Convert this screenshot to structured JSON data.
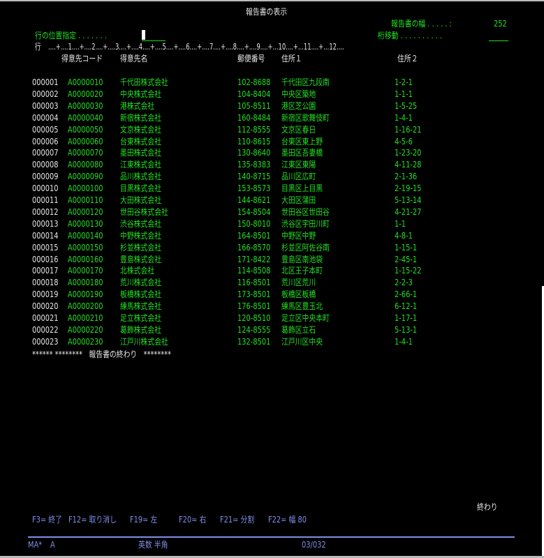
{
  "title": "報告書の表示",
  "report_width_label": "報告書の幅 . . . . . :",
  "report_width_value": "252",
  "position_label": "行の位置指定 . . . . . . .",
  "position_value": "",
  "shift_label": "桁移動 . . . . . . . . . .",
  "shift_value": "",
  "ruler": "行    ....+....1....+....2....+....3....+....4....+....5....+....6....+....7....+....8....+....9....+...10....+...11....+...12....",
  "headers": {
    "code": "得意先コード",
    "name": "得意先名",
    "zip": "郵便番号",
    "addr1": "住所１",
    "addr2": "住所２"
  },
  "rows": [
    [
      "000001",
      "A0000010",
      "千代田株式会社",
      "102-8688",
      "千代田区九段南",
      "1-2-1"
    ],
    [
      "000002",
      "A0000020",
      "中央株式会社",
      "104-8404",
      "中央区築地",
      "1-1-1"
    ],
    [
      "000003",
      "A0000030",
      "港株式会社",
      "105-8511",
      "港区芝公園",
      "1-5-25"
    ],
    [
      "000004",
      "A0000040",
      "新宿株式会社",
      "160-8484",
      "新宿区歌舞伎町",
      "1-4-1"
    ],
    [
      "000005",
      "A0000050",
      "文京株式会社",
      "112-8555",
      "文京区春日",
      "1-16-21"
    ],
    [
      "000006",
      "A0000060",
      "台東株式会社",
      "110-8615",
      "台東区東上野",
      "4-5-6"
    ],
    [
      "000007",
      "A0000070",
      "墨田株式会社",
      "130-8640",
      "墨田区吾妻橋",
      "1-23-20"
    ],
    [
      "000008",
      "A0000080",
      "江東株式会社",
      "135-8383",
      "江東区東陽",
      "4-11-28"
    ],
    [
      "000009",
      "A0000090",
      "品川株式会社",
      "140-8715",
      "品川区広町",
      "2-1-36"
    ],
    [
      "000010",
      "A0000100",
      "目黒株式会社",
      "153-8573",
      "目黒区上目黒",
      "2-19-15"
    ],
    [
      "000011",
      "A0000110",
      "大田株式会社",
      "144-8621",
      "大田区蒲田",
      "5-13-14"
    ],
    [
      "000012",
      "A0000120",
      "世田谷株式会社",
      "154-8504",
      "世田谷区世田谷",
      "4-21-27"
    ],
    [
      "000013",
      "A0000130",
      "渋谷株式会社",
      "150-8010",
      "渋谷区宇田川町",
      "1-1"
    ],
    [
      "000014",
      "A0000140",
      "中野株式会社",
      "164-8501",
      "中野区中野",
      "4-8-1"
    ],
    [
      "000015",
      "A0000150",
      "杉並株式会社",
      "166-8570",
      "杉並区阿佐谷南",
      "1-15-1"
    ],
    [
      "000016",
      "A0000160",
      "豊島株式会社",
      "171-8422",
      "豊島区南池袋",
      "2-45-1"
    ],
    [
      "000017",
      "A0000170",
      "北株式会社",
      "114-8508",
      "北区王子本町",
      "1-15-22"
    ],
    [
      "000018",
      "A0000180",
      "荒川株式会社",
      "116-8501",
      "荒川区荒川",
      "2-2-3"
    ],
    [
      "000019",
      "A0000190",
      "板橋株式会社",
      "173-8501",
      "板橋区板橋",
      "2-66-1"
    ],
    [
      "000020",
      "A0000200",
      "練馬株式会社",
      "176-8501",
      "練馬区豊玉北",
      "6-12-1"
    ],
    [
      "000021",
      "A0000210",
      "足立株式会社",
      "120-8510",
      "足立区中央本町",
      "1-17-1"
    ],
    [
      "000022",
      "A0000220",
      "葛飾株式会社",
      "124-8555",
      "葛飾区立石",
      "5-13-1"
    ],
    [
      "000023",
      "A0000230",
      "江戸川株式会社",
      "132-8501",
      "江戸川区中央",
      "1-4-1"
    ]
  ],
  "end_of_report": "****** ********   報告書の終わり   ********",
  "bottom_status": "終わり",
  "function_keys": [
    "F3= 終了",
    "F12= 取り消し",
    "F19= 左",
    "F20= 右",
    "F21= 分割",
    "F22= 幅 80"
  ],
  "status_bar": {
    "session": "MA*",
    "mode": "A",
    "input_mode": "英数 半角",
    "cursor_pos": "03/032"
  }
}
